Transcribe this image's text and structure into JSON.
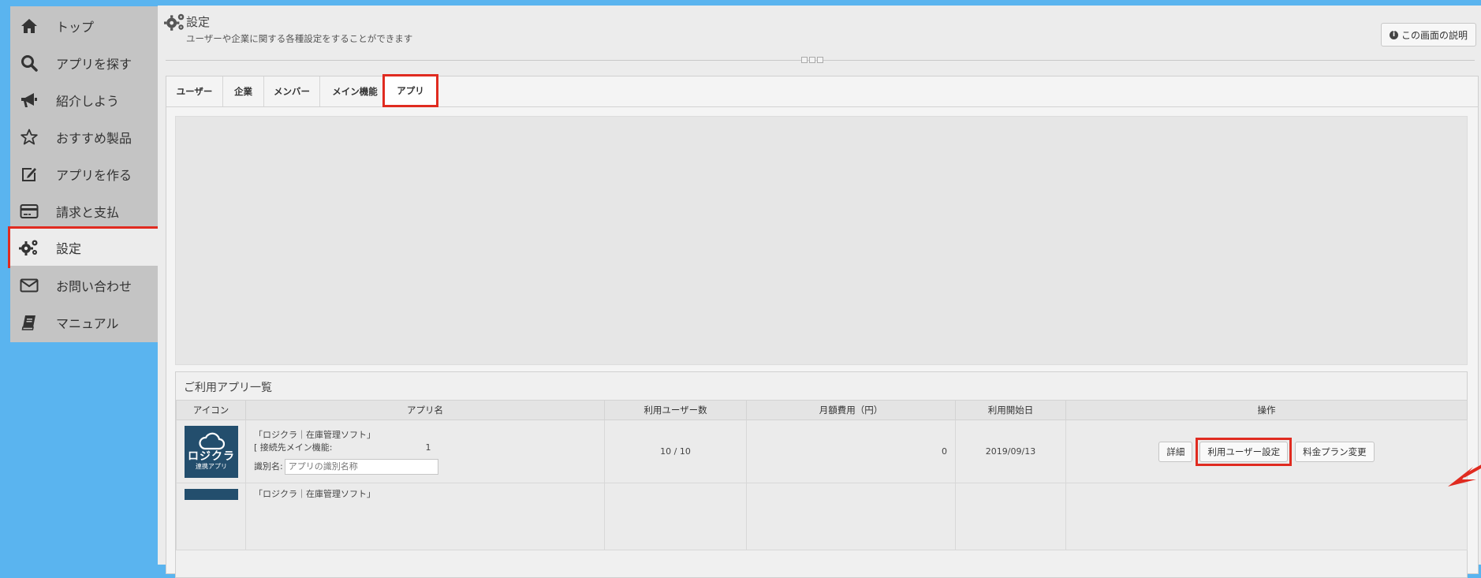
{
  "sidebar": {
    "items": [
      {
        "label": "トップ",
        "icon": "home-icon"
      },
      {
        "label": "アプリを探す",
        "icon": "search-icon"
      },
      {
        "label": "紹介しよう",
        "icon": "megaphone-icon"
      },
      {
        "label": "おすすめ製品",
        "icon": "star-icon"
      },
      {
        "label": "アプリを作る",
        "icon": "edit-icon"
      },
      {
        "label": "請求と支払",
        "icon": "credit-card-icon"
      },
      {
        "label": "設定",
        "icon": "gears-icon",
        "active": true
      },
      {
        "label": "お問い合わせ",
        "icon": "envelope-icon"
      },
      {
        "label": "マニュアル",
        "icon": "book-icon"
      }
    ]
  },
  "header": {
    "title": "設定",
    "subtitle": "ユーザーや企業に関する各種設定をすることができます",
    "help_label": "この画面の説明"
  },
  "tabs": [
    {
      "label": "ユーザー"
    },
    {
      "label": "企業"
    },
    {
      "label": "メンバー"
    },
    {
      "label": "メイン機能"
    },
    {
      "label": "アプリ",
      "active": true
    }
  ],
  "app_list": {
    "title": "ご利用アプリ一覧",
    "columns": [
      "アイコン",
      "アプリ名",
      "利用ユーザー数",
      "月額費用（円）",
      "利用開始日",
      "操作"
    ],
    "rows": [
      {
        "icon_brand": "ロジクラ",
        "icon_sub": "連携アプリ",
        "name": "「ロジクラ｜在庫管理ソフト」",
        "connection_prefix": "[ 接続先メイン機能:",
        "connection_suffix": "1",
        "alias_label": "識別名:",
        "alias_placeholder": "アプリの識別名称",
        "users": "10 / 10",
        "monthly_fee": "0",
        "start_date": "2019/09/13",
        "actions": [
          "詳細",
          "利用ユーザー設定",
          "料金プラン変更"
        ]
      },
      {
        "icon_brand": "",
        "icon_sub": "",
        "name": "「ロジクラ｜在庫管理ソフト」"
      }
    ]
  },
  "colors": {
    "accent_red": "#e02b20",
    "sidebar_blue": "#5ab4ef",
    "app_icon_bg": "#234e6d"
  }
}
